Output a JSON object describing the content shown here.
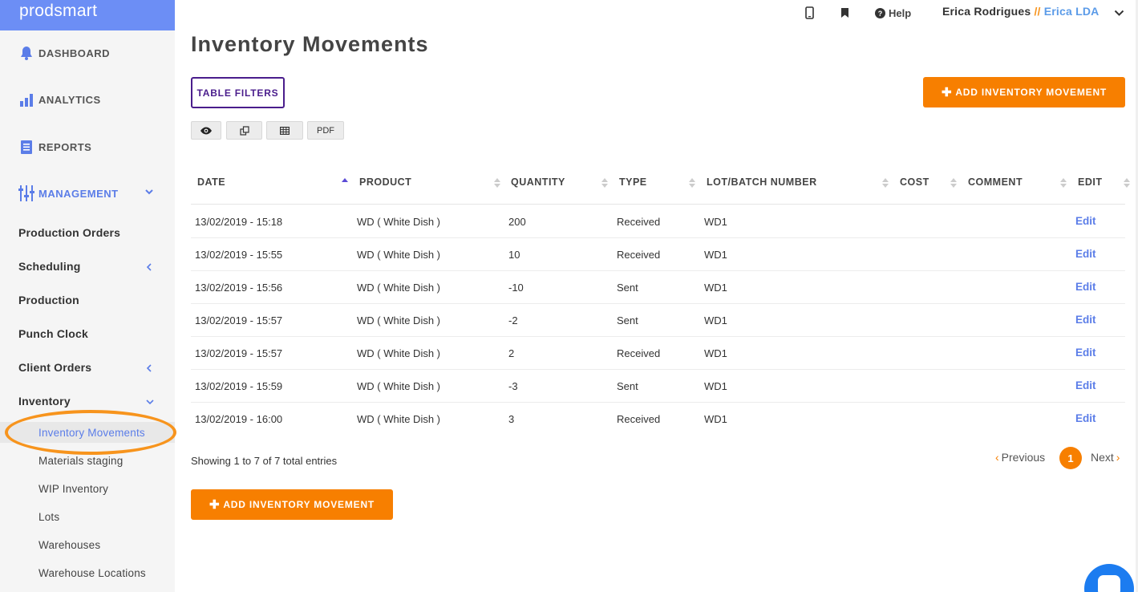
{
  "brand": "prodsmart",
  "sidebar": {
    "main": [
      {
        "label": "DASHBOARD",
        "icon": "bell-icon"
      },
      {
        "label": "ANALYTICS",
        "icon": "bar-chart-icon"
      },
      {
        "label": "REPORTS",
        "icon": "document-icon"
      },
      {
        "label": "MANAGEMENT",
        "icon": "sliders-icon"
      }
    ],
    "sub": [
      {
        "label": "Production Orders"
      },
      {
        "label": "Scheduling"
      },
      {
        "label": "Production"
      },
      {
        "label": "Punch Clock"
      },
      {
        "label": "Client Orders"
      },
      {
        "label": "Inventory"
      }
    ],
    "inventory_items": [
      {
        "label": "Inventory Movements"
      },
      {
        "label": "Materials staging"
      },
      {
        "label": "WIP Inventory"
      },
      {
        "label": "Lots"
      },
      {
        "label": "Warehouses"
      },
      {
        "label": "Warehouse Locations"
      }
    ]
  },
  "topbar": {
    "help": "Help",
    "user_name": "Erica Rodrigues",
    "separator": "//",
    "company": "Erica LDA"
  },
  "page": {
    "title": "Inventory Movements",
    "filters_label": "TABLE FILTERS",
    "add_label": "ADD INVENTORY MOVEMENT",
    "pdf_label": "PDF"
  },
  "table": {
    "headers": [
      "DATE",
      "PRODUCT",
      "QUANTITY",
      "TYPE",
      "LOT/BATCH NUMBER",
      "COST",
      "COMMENT",
      "EDIT"
    ],
    "rows": [
      {
        "date": "13/02/2019 - 15:18",
        "product": "WD ( White Dish )",
        "quantity": "200",
        "type": "Received",
        "lot": "WD1",
        "cost": "",
        "comment": "",
        "edit": "Edit"
      },
      {
        "date": "13/02/2019 - 15:55",
        "product": "WD ( White Dish )",
        "quantity": "10",
        "type": "Received",
        "lot": "WD1",
        "cost": "",
        "comment": "",
        "edit": "Edit"
      },
      {
        "date": "13/02/2019 - 15:56",
        "product": "WD ( White Dish )",
        "quantity": "-10",
        "type": "Sent",
        "lot": "WD1",
        "cost": "",
        "comment": "",
        "edit": "Edit"
      },
      {
        "date": "13/02/2019 - 15:57",
        "product": "WD ( White Dish )",
        "quantity": "-2",
        "type": "Sent",
        "lot": "WD1",
        "cost": "",
        "comment": "",
        "edit": "Edit"
      },
      {
        "date": "13/02/2019 - 15:57",
        "product": "WD ( White Dish )",
        "quantity": "2",
        "type": "Received",
        "lot": "WD1",
        "cost": "",
        "comment": "",
        "edit": "Edit"
      },
      {
        "date": "13/02/2019 - 15:59",
        "product": "WD ( White Dish )",
        "quantity": "-3",
        "type": "Sent",
        "lot": "WD1",
        "cost": "",
        "comment": "",
        "edit": "Edit"
      },
      {
        "date": "13/02/2019 - 16:00",
        "product": "WD ( White Dish )",
        "quantity": "3",
        "type": "Received",
        "lot": "WD1",
        "cost": "",
        "comment": "",
        "edit": "Edit"
      }
    ]
  },
  "footer": {
    "showing": "Showing 1 to 7 of 7 total entries",
    "previous": "Previous",
    "page": "1",
    "next": "Next"
  },
  "colors": {
    "accent": "#f77f00",
    "brand": "#6c8ef5",
    "link": "#5b7de8",
    "filters_border": "#4a1d8c"
  }
}
